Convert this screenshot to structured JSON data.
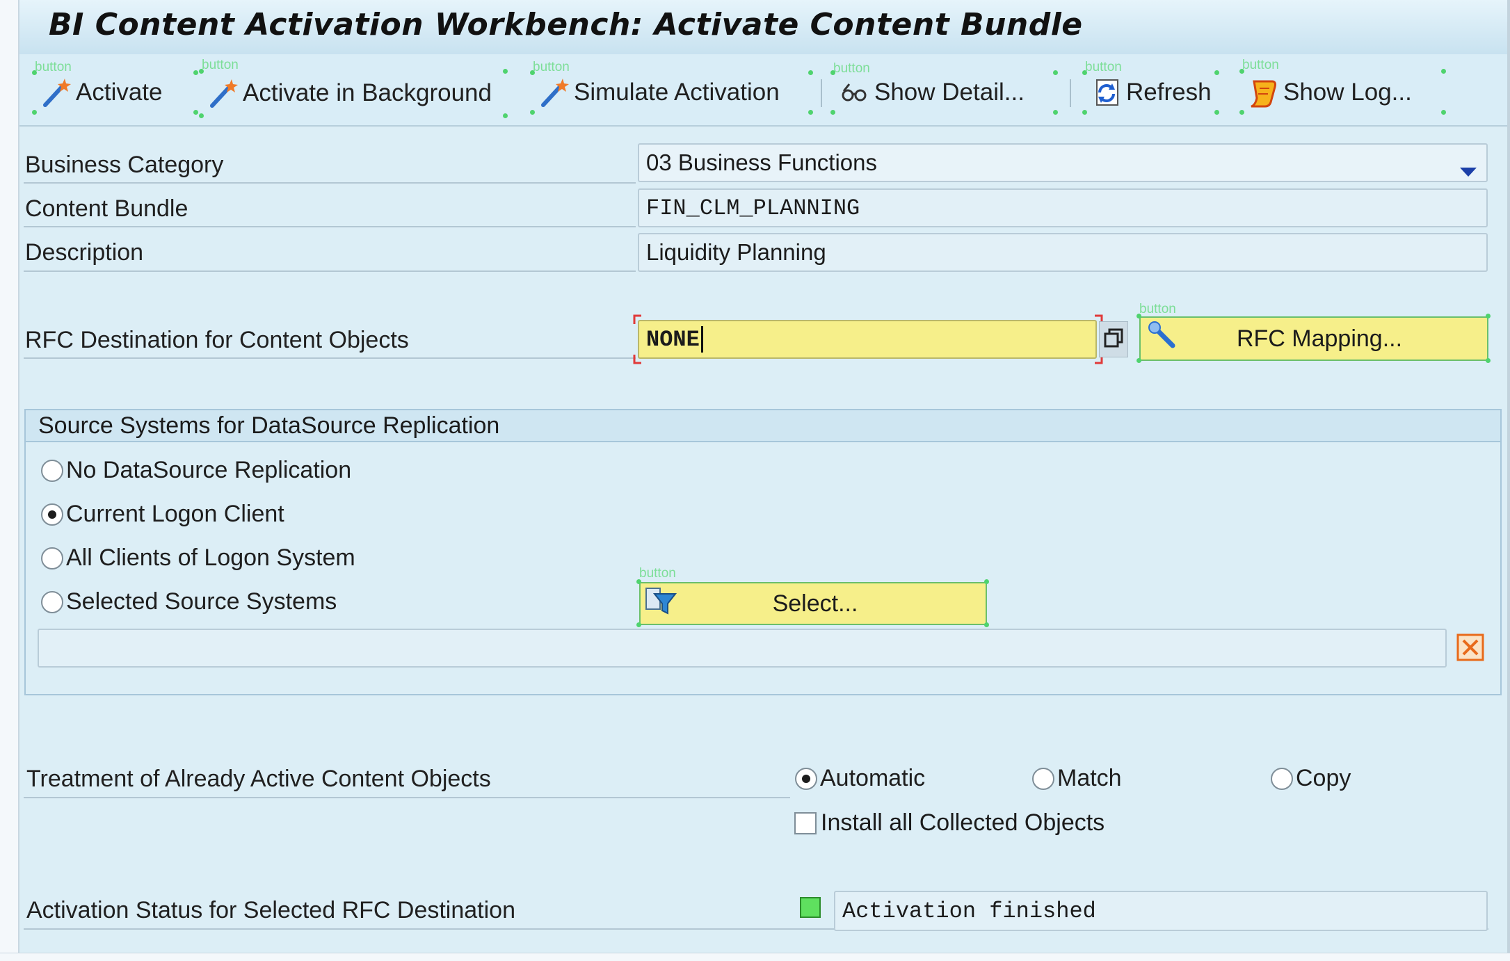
{
  "window": {
    "title": "BI Content Activation Workbench: Activate Content Bundle"
  },
  "toolbar": {
    "overlay_tag": "button",
    "buttons": [
      {
        "label": "Activate",
        "icon": "magic-wand-icon"
      },
      {
        "label": "Activate in Background",
        "icon": "magic-wand-icon"
      },
      {
        "label": "Simulate Activation",
        "icon": "magic-wand-icon"
      },
      {
        "label": "Show Detail...",
        "icon": "glasses-icon"
      },
      {
        "label": "Refresh",
        "icon": "refresh-icon"
      },
      {
        "label": "Show Log...",
        "icon": "scroll-log-icon"
      }
    ]
  },
  "form": {
    "business_category": {
      "label": "Business Category",
      "value": "03 Business Functions"
    },
    "content_bundle": {
      "label": "Content Bundle",
      "value": "FIN_CLM_PLANNING"
    },
    "description": {
      "label": "Description",
      "value": "Liquidity Planning"
    },
    "rfc_destination": {
      "label": "RFC Destination for Content Objects",
      "value": "NONE",
      "mapping_button": "RFC Mapping...",
      "overlay_tag": "button"
    }
  },
  "source_systems": {
    "title": "Source Systems for DataSource Replication",
    "options": [
      {
        "label": "No DataSource Replication",
        "selected": false
      },
      {
        "label": "Current Logon Client",
        "selected": true
      },
      {
        "label": "All Clients of Logon System",
        "selected": false
      },
      {
        "label": "Selected Source Systems",
        "selected": false
      }
    ],
    "select_button": "Select...",
    "select_overlay_tag": "button",
    "selected_systems_value": ""
  },
  "treatment": {
    "label": "Treatment of Already Active Content Objects",
    "options": [
      {
        "label": "Automatic",
        "selected": true
      },
      {
        "label": "Match",
        "selected": false
      },
      {
        "label": "Copy",
        "selected": false
      }
    ],
    "install_all": {
      "label": "Install all Collected Objects",
      "checked": false
    }
  },
  "activation_status": {
    "label": "Activation Status for Selected RFC Destination",
    "value": "Activation finished",
    "status_color": "#5fe05f"
  },
  "colors": {
    "accent_yellow": "#f6ef8a",
    "background": "#dceef6"
  }
}
